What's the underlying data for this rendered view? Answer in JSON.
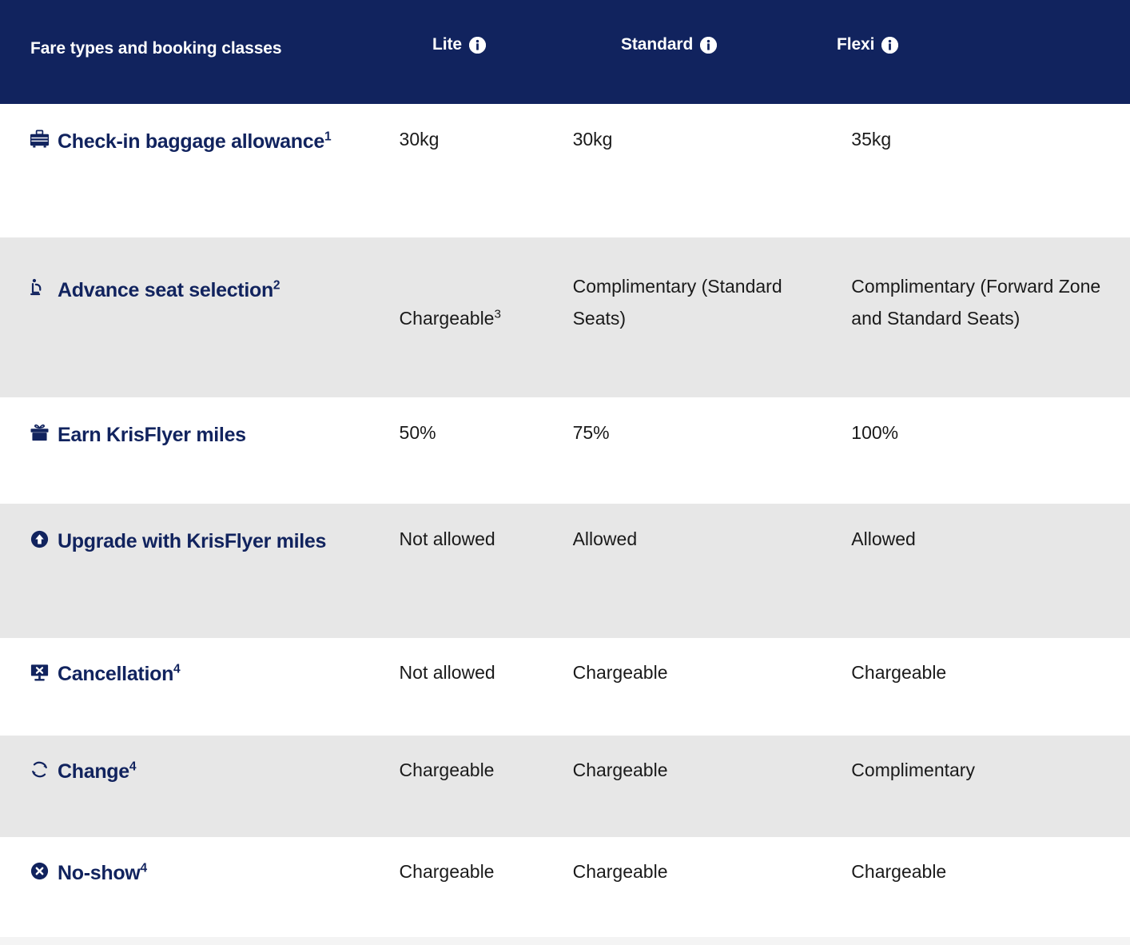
{
  "header": {
    "feature_column_label": "Fare types and booking classes",
    "fare_columns": [
      {
        "label": "Lite",
        "info_icon": "info-icon"
      },
      {
        "label": "Standard",
        "info_icon": "info-icon"
      },
      {
        "label": "Flexi",
        "info_icon": "info-icon"
      }
    ]
  },
  "colors": {
    "header_background": "#11235e",
    "brand_navy": "#11235e",
    "row_shaded": "#e7e7e7",
    "row_plain": "#ffffff",
    "value_text": "#1a1a1a"
  },
  "rows": [
    {
      "icon": "suitcase-icon",
      "label": "Check-in baggage allowance",
      "footnote": "1",
      "lite": "30kg",
      "lite_footnote": "",
      "standard": "30kg",
      "flexi": "35kg",
      "shaded": false
    },
    {
      "icon": "seat-icon",
      "label": "Advance seat selection",
      "footnote": "2",
      "lite": "Chargeable",
      "lite_footnote": "3",
      "standard": "Complimentary (Standard Seats)",
      "flexi": "Complimentary (Forward Zone and Standard Seats)",
      "shaded": true
    },
    {
      "icon": "gift-icon",
      "label": "Earn KrisFlyer miles",
      "footnote": "",
      "lite": "50%",
      "lite_footnote": "",
      "standard": "75%",
      "flexi": "100%",
      "shaded": false
    },
    {
      "icon": "upgrade-arrow-icon",
      "label": "Upgrade with KrisFlyer miles",
      "footnote": "",
      "lite": "Not allowed",
      "lite_footnote": "",
      "standard": "Allowed",
      "flexi": "Allowed",
      "shaded": true
    },
    {
      "icon": "cancel-screen-icon",
      "label": "Cancellation",
      "footnote": "4",
      "lite": "Not allowed",
      "lite_footnote": "",
      "standard": "Chargeable",
      "flexi": "Chargeable",
      "shaded": false
    },
    {
      "icon": "refresh-circle-icon",
      "label": "Change",
      "footnote": "4",
      "lite": "Chargeable",
      "lite_footnote": "",
      "standard": "Chargeable",
      "flexi": "Complimentary",
      "shaded": true
    },
    {
      "icon": "x-circle-icon",
      "label": "No-show",
      "footnote": "4",
      "lite": "Chargeable",
      "lite_footnote": "",
      "standard": "Chargeable",
      "flexi": "Chargeable",
      "shaded": false
    }
  ]
}
